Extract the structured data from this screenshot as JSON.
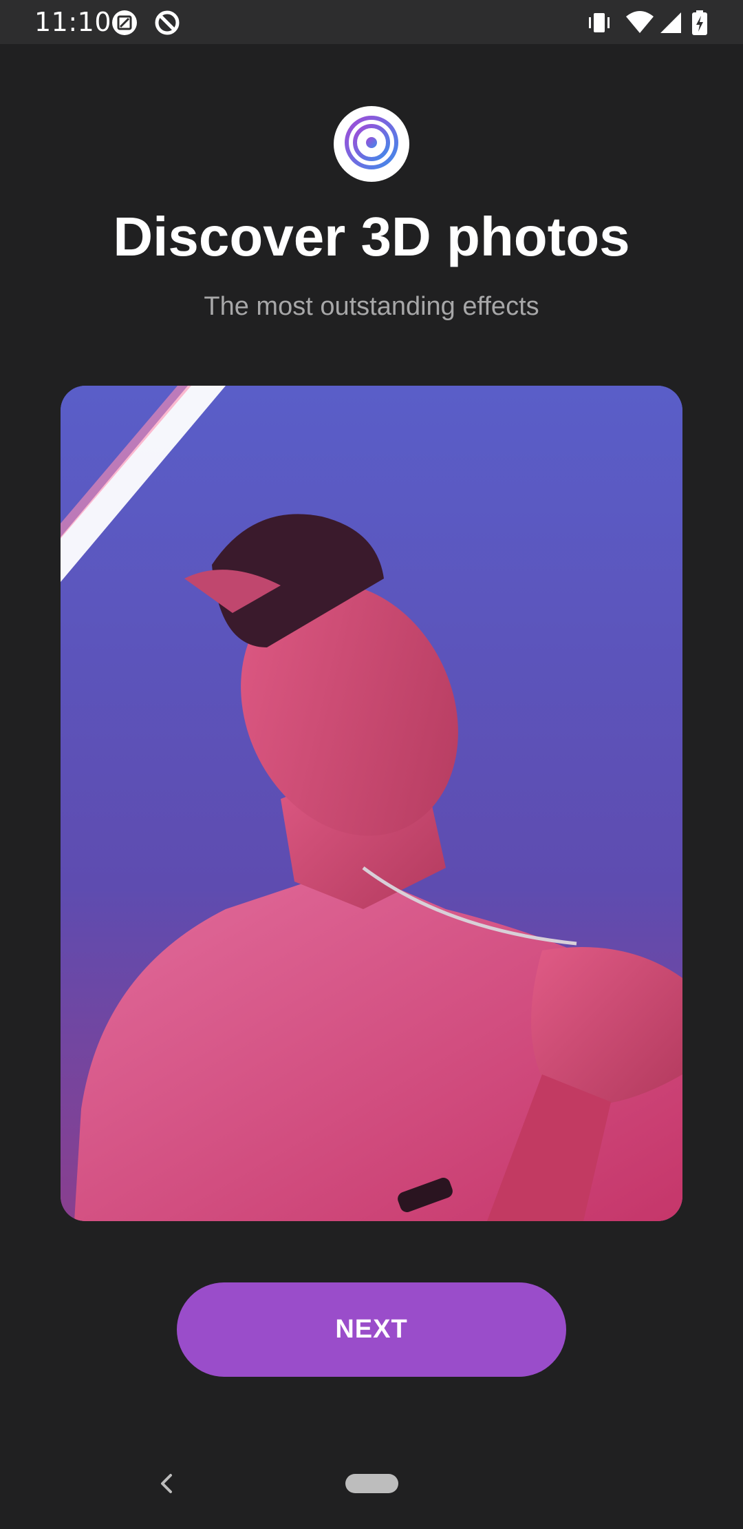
{
  "status_bar": {
    "time": "11:10",
    "icons_left": [
      "screenshot-icon",
      "data-saver-icon"
    ],
    "icons_right": [
      "vibrate-icon",
      "wifi-icon",
      "cell-signal-icon",
      "battery-charging-icon"
    ]
  },
  "onboarding": {
    "logo_icon": "concentric-circles-logo-icon",
    "title": "Discover 3D photos",
    "subtitle": "The most outstanding effects",
    "next_label": "NEXT"
  },
  "colors": {
    "background": "#202021",
    "accent": "#9a4dca",
    "subtitle": "#a7a7a8"
  },
  "nav_bar": {
    "back_icon": "back-chevron-icon",
    "home_icon": "home-pill-icon"
  }
}
